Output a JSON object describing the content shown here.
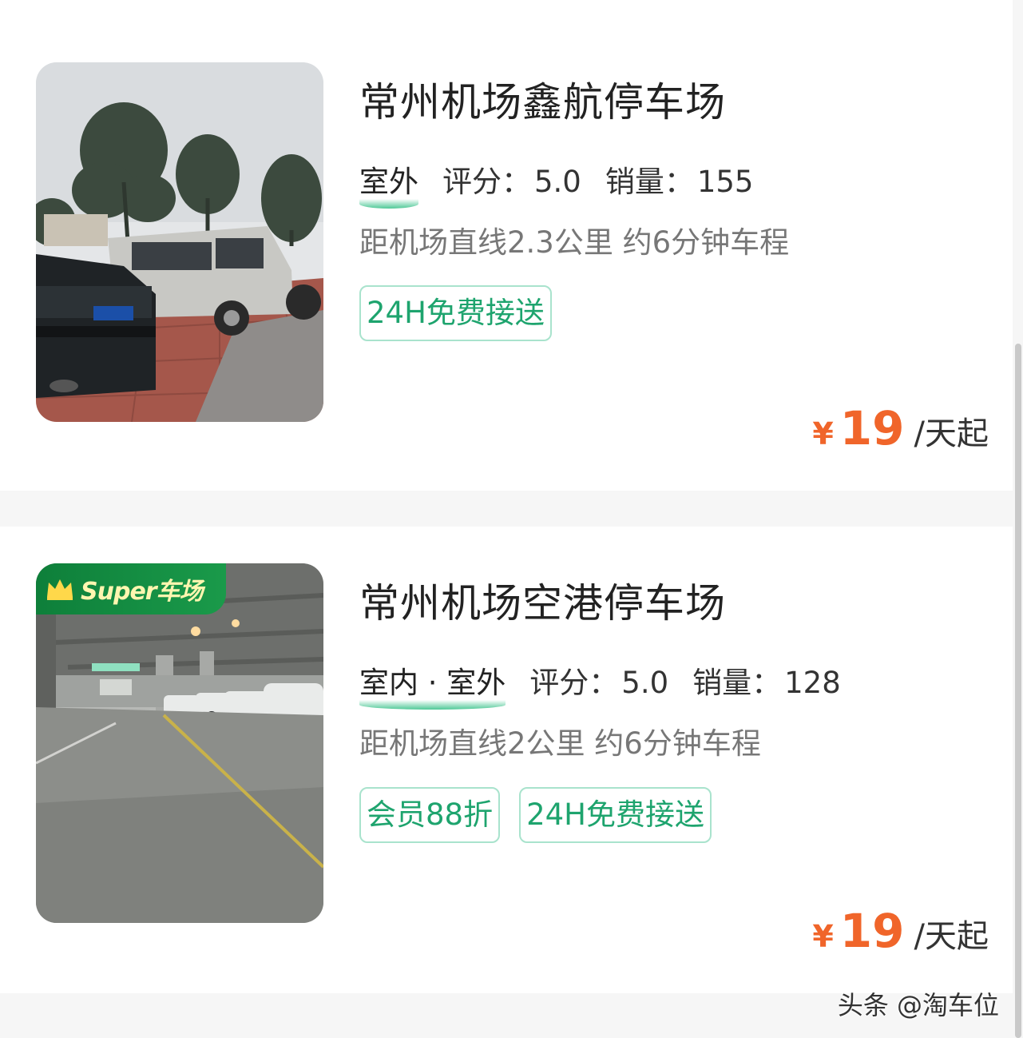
{
  "listings": [
    {
      "name": "常州机场鑫航停车场",
      "location_type": "室外",
      "rating_label": "评分：",
      "rating": "5.0",
      "sales_label": "销量：",
      "sales": "155",
      "distance": "距机场直线2.3公里 约6分钟车程",
      "tags": [
        "24H免费接送"
      ],
      "price_currency": "¥",
      "price": "19",
      "price_unit": "/天起",
      "photo": "outdoor-parking-photo"
    },
    {
      "name": "常州机场空港停车场",
      "location_type": "室内 · 室外",
      "rating_label": "评分：",
      "rating": "5.0",
      "sales_label": "销量：",
      "sales": "128",
      "distance": "距机场直线2公里 约6分钟车程",
      "tags": [
        "会员88折",
        "24H免费接送"
      ],
      "price_currency": "¥",
      "price": "19",
      "price_unit": "/天起",
      "badge": "Super车场",
      "photo": "indoor-parking-photo"
    }
  ],
  "watermark": "头条 @淘车位",
  "colors": {
    "accent_green": "#1ea46e",
    "tag_border": "#a9e3cd",
    "price_orange": "#f0652a",
    "badge_green": "#0e7f3a"
  }
}
